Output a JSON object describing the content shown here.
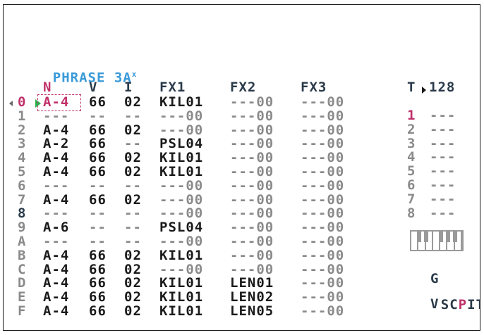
{
  "title": "PHRASE 3A",
  "title_mark": "x",
  "columns": {
    "note": "N",
    "volume": "V",
    "instrument": "I",
    "fx1": "FX1",
    "fx2": "FX2",
    "fx3": "FX3"
  },
  "tempo_label": "T",
  "tempo_value": "128",
  "colors": {
    "title": "#3a9ad9",
    "accent": "#c0306a",
    "play": "#2bb24c",
    "muted": "#8a8a8a",
    "text": "#1a1a1a"
  },
  "rows": [
    {
      "idx": "0",
      "note": "A-4",
      "vol": "66",
      "inst": "02",
      "fx1": "KIL01",
      "fx2": "---00",
      "fx3": "---00"
    },
    {
      "idx": "1",
      "note": "---",
      "vol": "--",
      "inst": "--",
      "fx1": "---00",
      "fx2": "---00",
      "fx3": "---00"
    },
    {
      "idx": "2",
      "note": "A-4",
      "vol": "66",
      "inst": "02",
      "fx1": "---00",
      "fx2": "---00",
      "fx3": "---00"
    },
    {
      "idx": "3",
      "note": "A-2",
      "vol": "66",
      "inst": "--",
      "fx1": "PSL04",
      "fx2": "---00",
      "fx3": "---00"
    },
    {
      "idx": "4",
      "note": "A-4",
      "vol": "66",
      "inst": "02",
      "fx1": "KIL01",
      "fx2": "---00",
      "fx3": "---00"
    },
    {
      "idx": "5",
      "note": "A-4",
      "vol": "66",
      "inst": "02",
      "fx1": "KIL01",
      "fx2": "---00",
      "fx3": "---00"
    },
    {
      "idx": "6",
      "note": "---",
      "vol": "--",
      "inst": "--",
      "fx1": "---00",
      "fx2": "---00",
      "fx3": "---00"
    },
    {
      "idx": "7",
      "note": "A-4",
      "vol": "66",
      "inst": "02",
      "fx1": "---00",
      "fx2": "---00",
      "fx3": "---00"
    },
    {
      "idx": "8",
      "note": "---",
      "vol": "--",
      "inst": "--",
      "fx1": "---00",
      "fx2": "---00",
      "fx3": "---00"
    },
    {
      "idx": "9",
      "note": "A-6",
      "vol": "--",
      "inst": "--",
      "fx1": "PSL04",
      "fx2": "---00",
      "fx3": "---00"
    },
    {
      "idx": "A",
      "note": "---",
      "vol": "--",
      "inst": "--",
      "fx1": "---00",
      "fx2": "---00",
      "fx3": "---00"
    },
    {
      "idx": "B",
      "note": "A-4",
      "vol": "66",
      "inst": "02",
      "fx1": "KIL01",
      "fx2": "---00",
      "fx3": "---00"
    },
    {
      "idx": "C",
      "note": "A-4",
      "vol": "66",
      "inst": "02",
      "fx1": "---00",
      "fx2": "---00",
      "fx3": "---00"
    },
    {
      "idx": "D",
      "note": "A-4",
      "vol": "66",
      "inst": "02",
      "fx1": "KIL01",
      "fx2": "LEN01",
      "fx3": "---00"
    },
    {
      "idx": "E",
      "note": "A-4",
      "vol": "66",
      "inst": "02",
      "fx1": "KIL01",
      "fx2": "LEN02",
      "fx3": "---00"
    },
    {
      "idx": "F",
      "note": "A-4",
      "vol": "66",
      "inst": "02",
      "fx1": "KIL01",
      "fx2": "LEN05",
      "fx3": "---00"
    }
  ],
  "channels": [
    {
      "num": "1",
      "val": "---"
    },
    {
      "num": "2",
      "val": "---"
    },
    {
      "num": "3",
      "val": "---"
    },
    {
      "num": "4",
      "val": "---"
    },
    {
      "num": "5",
      "val": "---"
    },
    {
      "num": "6",
      "val": "---"
    },
    {
      "num": "7",
      "val": "---"
    },
    {
      "num": "8",
      "val": "---"
    }
  ],
  "nav": {
    "top": "G",
    "left": "SC",
    "center": "P",
    "right": "IT",
    "bottom": "V"
  }
}
